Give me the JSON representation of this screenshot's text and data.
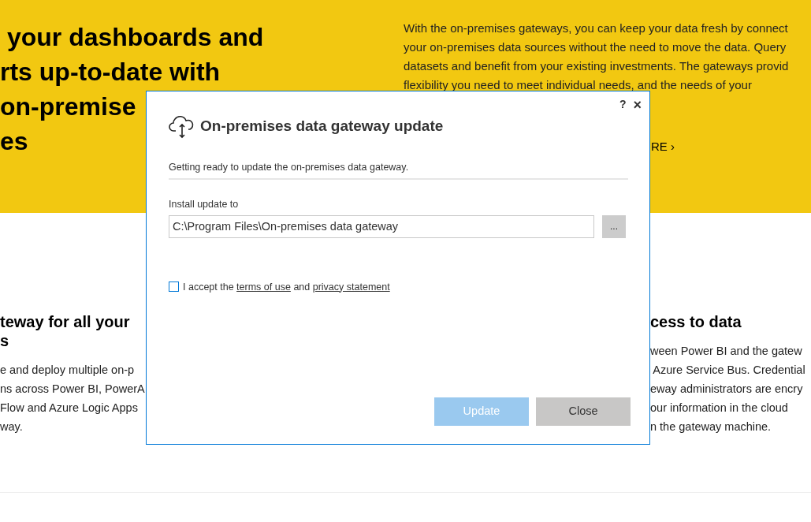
{
  "hero": {
    "heading_lines": [
      " your dashboards and",
      "rts up-to-date with",
      "on-premise",
      "es"
    ],
    "paragraph_lines": [
      "With the on-premises gateways, you can keep your data fresh by connect",
      "your on-premises data sources without the need to move the data. Query",
      "datasets and benefit from your existing investments. The gateways provid",
      "flexibility you need to meet individual needs, and the needs of your"
    ],
    "link": "RE ›"
  },
  "features": [
    {
      "heading_lines": [
        "teway for all your",
        "s"
      ],
      "lines": [
        "e and deploy multiple on-p",
        "ns across Power BI, PowerA",
        "Flow and Azure Logic Apps",
        "way."
      ]
    },
    {
      "heading_lines": [
        "cess to data"
      ],
      "lines": [
        "ween Power BI and the gatew",
        " Azure Service Bus. Credential",
        "eway administrators are encry",
        "our information in the cloud",
        "n the gateway machine."
      ]
    }
  ],
  "dialog": {
    "help": "?",
    "close": "×",
    "title": "On-premises data gateway update",
    "status": "Getting ready to update the on-premises data gateway.",
    "path_label": "Install update to",
    "path_value": "C:\\Program Files\\On-premises data gateway",
    "browse": "...",
    "accept": {
      "checked": false,
      "text": "I accept the",
      "link1": "terms of use",
      "middle": "and",
      "link2": "privacy statement"
    },
    "buttons": [
      {
        "label": "Update",
        "kind": "primary",
        "disabled": true
      },
      {
        "label": "Close",
        "kind": "secondary",
        "disabled": false
      }
    ]
  }
}
